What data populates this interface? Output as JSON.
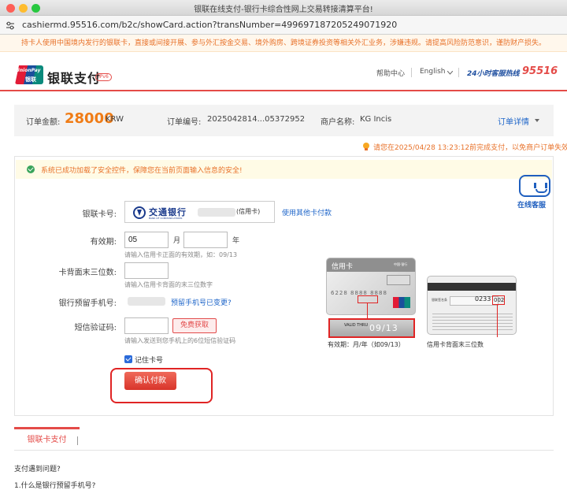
{
  "window": {
    "title": "银联在线支付-银行卡综合性网上交易转接清算平台!"
  },
  "address_bar": {
    "url": "cashiermd.95516.com/b2c/showCard.action?transNumber=499697187205249071920"
  },
  "notice": "持卡人使用中国境内发行的银联卡，直接或间接开展、参与外汇按金交易、境外购房、跨境证券投资等相关外汇业务，涉嫌违规。请提高风险防范意识，谨防财产损失。",
  "header": {
    "logo_text": "UnionPay",
    "logo_sub": "银联",
    "brand": "银联支付",
    "ipv6": "IPv6",
    "help": "帮助中心",
    "lang": "English",
    "hotline_label": "24小时客服热线",
    "hotline_number": "95516"
  },
  "order": {
    "amount_label": "订单金额:",
    "amount": "28000",
    "currency": "KRW",
    "number_label": "订单编号:",
    "number": "2025042814...05372952",
    "merchant_label": "商户名称:",
    "merchant": "KG Incis",
    "details": "订单详情"
  },
  "deadline": "请您在2025/04/28 13:23:12前完成支付，以免商户订单失效",
  "security": "系统已成功加载了安全控件，保障您在当前页面输入信息的安全!",
  "customer_service": "在线客服",
  "form": {
    "card_label": "银联卡号:",
    "bank_name": "交通银行",
    "bank_en": "BANK OF COMMUNICATIONS",
    "card_type": "(信用卡)",
    "other_card": "使用其他卡付款",
    "expiry_label": "有效期:",
    "expiry_month": "05",
    "expiry_year": "",
    "month_unit": "月",
    "year_unit": "年",
    "expiry_hint": "请输入信用卡正面的有效期，如：09/13",
    "cvn_label": "卡背面末三位数:",
    "cvn_value": "",
    "cvn_hint": "请输入信用卡背面的末三位数字",
    "phone_label": "银行预留手机号:",
    "phone_change": "预留手机号已变更?",
    "sms_label": "短信验证码:",
    "sms_value": "",
    "sms_button": "免费获取",
    "sms_hint": "请输入发送到您手机上的6位短信验证码",
    "remember": "记住卡号",
    "confirm": "确认付款"
  },
  "illustration": {
    "front_title": "信用卡",
    "front_small": "中国·银行",
    "front_number": "6228 8888 8888",
    "front_brand": "UnionPay",
    "valid_thru": "VALID THRU",
    "valid_date": "09/13",
    "front_caption": "有效期：月/年（如09/13）",
    "back_sign": "银联签名条",
    "back_number": "0233",
    "back_cvn": "002",
    "back_caption": "信用卡背面末三位数"
  },
  "tabs": {
    "active": "银联卡支付"
  },
  "faq": {
    "title": "支付遇到问题?",
    "q1": "1.什么是银行预留手机号?"
  },
  "colors": {
    "brand_red": "#e44b48",
    "amount_orange": "#f07c16",
    "link_blue": "#1f66c9"
  }
}
